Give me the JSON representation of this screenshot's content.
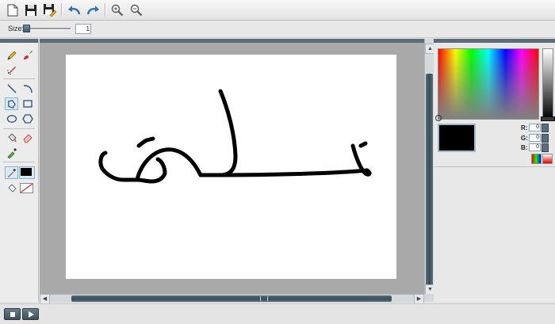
{
  "toolbar": {
    "buttons": [
      {
        "name": "new-file-icon"
      },
      {
        "name": "save-icon"
      },
      {
        "name": "save-as-icon"
      },
      {
        "name": "undo-icon"
      },
      {
        "name": "redo-icon"
      },
      {
        "name": "zoom-in-icon"
      },
      {
        "name": "zoom-out-icon"
      }
    ]
  },
  "size_bar": {
    "label": "Size:",
    "value": "1",
    "slider_fraction": 0.0
  },
  "tools": [
    "pencil-icon",
    "brush-icon",
    "airbrush-icon",
    "line-icon",
    "curve-icon",
    "polygon-select-icon",
    "rectangle-icon",
    "ellipse-icon",
    "hexagon-icon",
    "fill-bucket-icon",
    "eraser-icon",
    "eyedropper-icon",
    "color-picker-icon",
    "fill-mode-icon",
    "no-fill-icon"
  ],
  "canvas": {
    "drawing_text": "تقانة",
    "stroke_color": "#000000",
    "background": "#ffffff"
  },
  "color_panel": {
    "current_color": "#000000",
    "r_label": "R:",
    "g_label": "G:",
    "b_label": "B:",
    "r_value": "0",
    "g_value": "0",
    "b_value": "0"
  },
  "colors": {
    "panel_header": "#5b6c76",
    "scroll_thumb": "#3a4c56",
    "canvas_bg": "#a9a9a9"
  }
}
